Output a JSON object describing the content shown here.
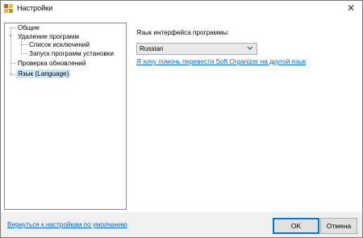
{
  "window": {
    "title": "Настройки",
    "close_glyph": "✕"
  },
  "tree": {
    "items": [
      {
        "label": "Общие",
        "level": 0,
        "expanded": null,
        "selected": false
      },
      {
        "label": "Удаление программ",
        "level": 0,
        "expanded": true,
        "selected": false
      },
      {
        "label": "Список исключений",
        "level": 1,
        "expanded": null,
        "selected": false
      },
      {
        "label": "Запуск программ установки",
        "level": 1,
        "expanded": null,
        "selected": false
      },
      {
        "label": "Проверка обновлений",
        "level": 0,
        "expanded": null,
        "selected": false
      },
      {
        "label": "Язык (Language)",
        "level": 0,
        "expanded": null,
        "selected": true
      }
    ],
    "expander_glyph": "⌄",
    "selection_color": "#cce8ff"
  },
  "language": {
    "label": "Язык интерфейса программы:",
    "selected": "Russian",
    "translate_link": "Я хочу помочь перевести Soft Organizer на другой язык"
  },
  "footer": {
    "reset_link": "Вернуться к настройкам по умолчанию",
    "ok_label": "OK",
    "cancel_label": "Отмена"
  },
  "colors": {
    "link": "#0066cc",
    "accent": "#0078d7"
  }
}
